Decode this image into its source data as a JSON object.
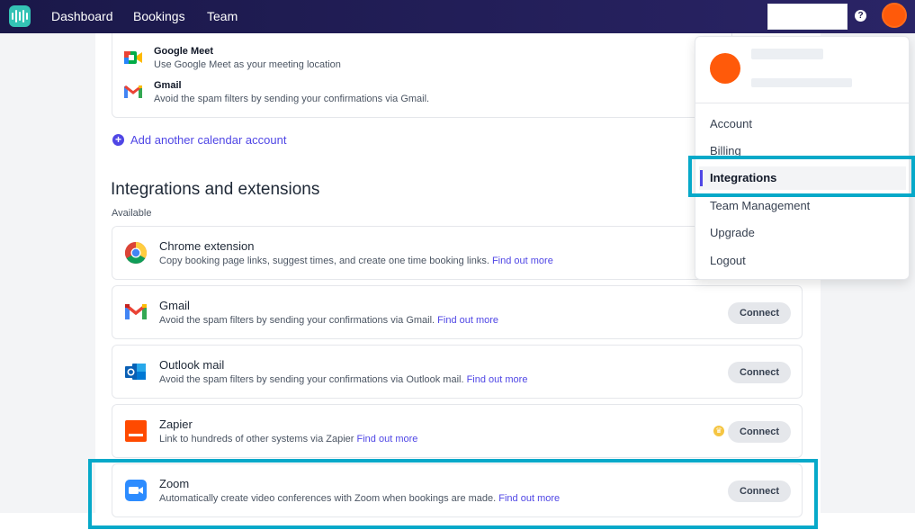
{
  "topnav": {
    "links": [
      "Dashboard",
      "Bookings",
      "Team"
    ],
    "help_icon": "?"
  },
  "calendar_card": {
    "rows": [
      {
        "name": "Google Meet",
        "desc": "Use Google Meet as your meeting location",
        "icon": "google-meet-icon"
      },
      {
        "name": "Gmail",
        "desc": "Avoid the spam filters by sending your confirmations via Gmail.",
        "icon": "gmail-icon"
      }
    ],
    "add_account": "Add another calendar account"
  },
  "integrations": {
    "title": "Integrations and extensions",
    "available_label": "Available",
    "items": [
      {
        "name": "Chrome extension",
        "desc": "Copy booking page links, suggest times, and create one time booking links.",
        "link": "Find out more",
        "icon": "chrome-icon"
      },
      {
        "name": "Gmail",
        "desc": "Avoid the spam filters by sending your confirmations via Gmail.",
        "link": "Find out more",
        "button": "Connect",
        "icon": "gmail-icon"
      },
      {
        "name": "Outlook mail",
        "desc": "Avoid the spam filters by sending your confirmations via Outlook mail.",
        "link": "Find out more",
        "button": "Connect",
        "icon": "outlook-icon"
      },
      {
        "name": "Zapier",
        "desc": "Link to hundreds of other systems via Zapier",
        "link": "Find out more",
        "button": "Connect",
        "icon": "zapier-icon"
      },
      {
        "name": "Zoom",
        "desc": "Automatically create video conferences with Zoom when bookings are made.",
        "link": "Find out more",
        "button": "Connect",
        "icon": "zoom-icon"
      }
    ]
  },
  "dropdown": {
    "items": [
      "Account",
      "Billing",
      "Integrations",
      "Team Management",
      "Upgrade",
      "Logout"
    ],
    "active": "Integrations"
  },
  "colors": {
    "nav_bg": "#1e1b4b",
    "accent": "#4f46e5",
    "highlight": "#06a9c9",
    "avatar": "#ff5a0a"
  }
}
